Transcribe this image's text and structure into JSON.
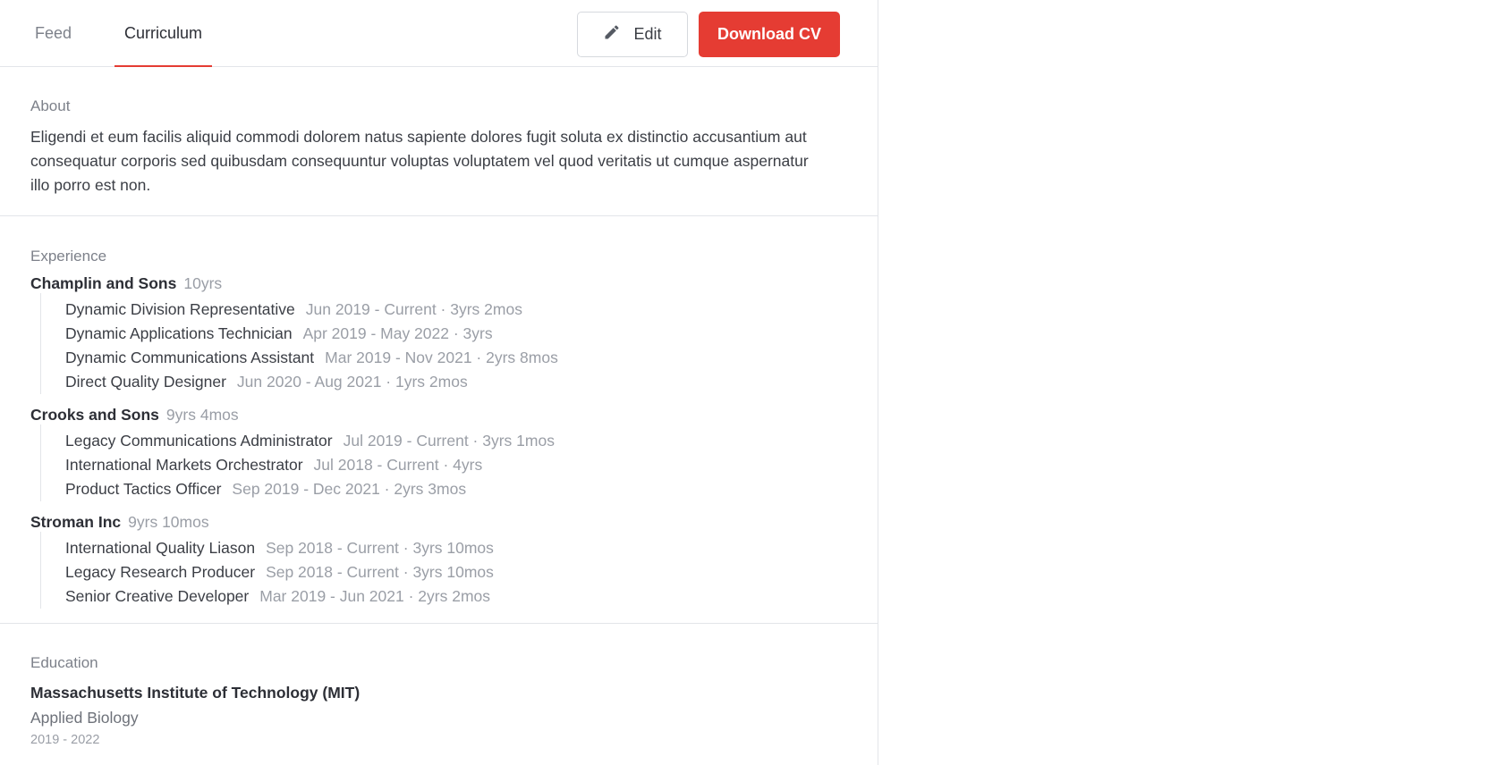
{
  "tabs": {
    "feed": "Feed",
    "curriculum": "Curriculum"
  },
  "actions": {
    "edit": "Edit",
    "download": "Download CV"
  },
  "colors": {
    "accent": "#e53c33"
  },
  "icons": {
    "edit": "pencil-icon"
  },
  "about": {
    "label": "About",
    "text": "Eligendi et eum facilis aliquid commodi dolorem natus sapiente dolores fugit soluta ex distinctio accusantium aut consequatur corporis sed quibusdam consequuntur voluptas voluptatem vel quod veritatis ut cumque aspernatur illo porro est non."
  },
  "experience": {
    "label": "Experience",
    "companies": [
      {
        "name": "Champlin and Sons",
        "duration": "10yrs",
        "roles": [
          {
            "title": "Dynamic Division Representative",
            "meta": "Jun 2019 - Current · 3yrs 2mos"
          },
          {
            "title": "Dynamic Applications Technician",
            "meta": "Apr 2019 - May 2022 · 3yrs"
          },
          {
            "title": "Dynamic Communications Assistant",
            "meta": "Mar 2019 - Nov 2021 · 2yrs 8mos"
          },
          {
            "title": "Direct Quality Designer",
            "meta": "Jun 2020 - Aug 2021 · 1yrs 2mos"
          }
        ]
      },
      {
        "name": "Crooks and Sons",
        "duration": "9yrs 4mos",
        "roles": [
          {
            "title": "Legacy Communications Administrator",
            "meta": "Jul 2019 - Current · 3yrs 1mos"
          },
          {
            "title": "International Markets Orchestrator",
            "meta": "Jul 2018 - Current · 4yrs"
          },
          {
            "title": "Product Tactics Officer",
            "meta": "Sep 2019 - Dec 2021 · 2yrs 3mos"
          }
        ]
      },
      {
        "name": "Stroman Inc",
        "duration": "9yrs 10mos",
        "roles": [
          {
            "title": "International Quality Liason",
            "meta": "Sep 2018 - Current · 3yrs 10mos"
          },
          {
            "title": "Legacy Research Producer",
            "meta": "Sep 2018 - Current · 3yrs 10mos"
          },
          {
            "title": "Senior Creative Developer",
            "meta": "Mar 2019 - Jun 2021 · 2yrs 2mos"
          }
        ]
      }
    ]
  },
  "education": {
    "label": "Education",
    "school": "Massachusetts Institute of Technology (MIT)",
    "field": "Applied Biology",
    "years": "2019 - 2022"
  }
}
